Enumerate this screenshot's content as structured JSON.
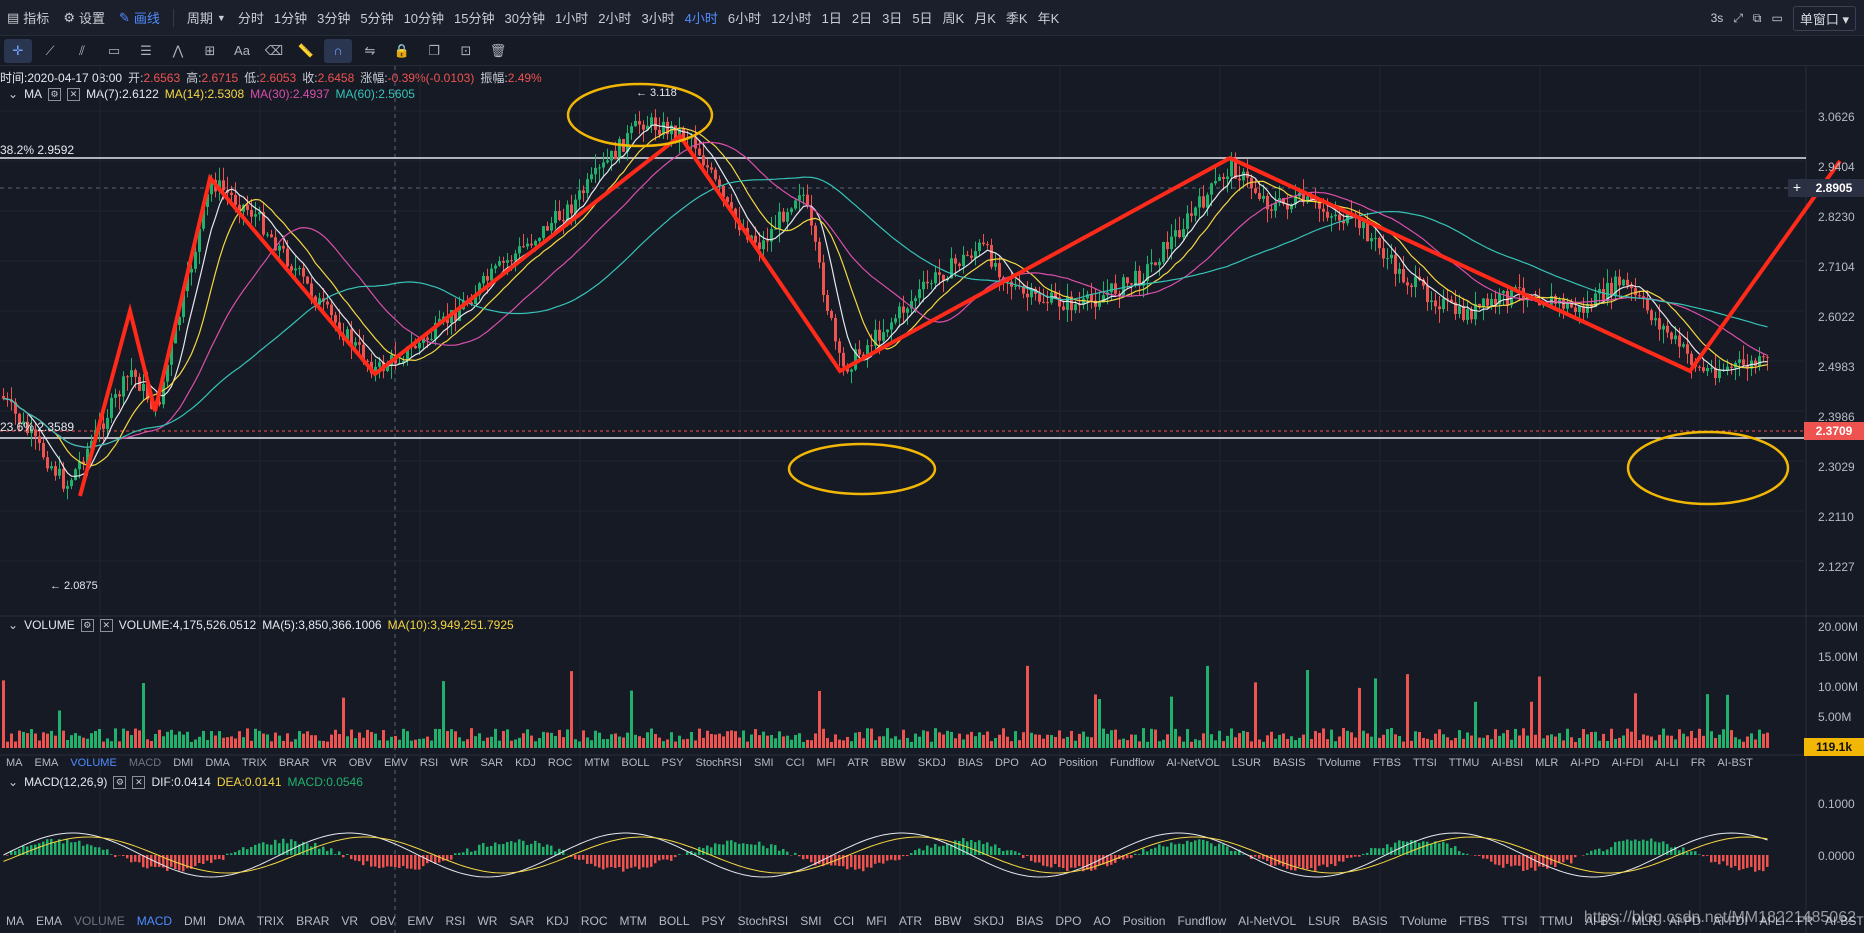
{
  "topbar": {
    "items": [
      {
        "icon": "indicator-icon",
        "label": "指标"
      },
      {
        "icon": "settings-icon",
        "label": "设置"
      },
      {
        "icon": "draw-icon",
        "label": "画线",
        "active": true
      }
    ],
    "period_label": "周期",
    "periods": [
      "分时",
      "1分钟",
      "3分钟",
      "5分钟",
      "10分钟",
      "15分钟",
      "30分钟",
      "1小时",
      "2小时",
      "3小时",
      "4小时",
      "6小时",
      "12小时",
      "1日",
      "2日",
      "3日",
      "5日",
      "周K",
      "月K",
      "季K",
      "年K"
    ],
    "active_period": "4小时",
    "refresh": "3s",
    "window_btn": "单窗口"
  },
  "ohlc": {
    "time": "时间:2020-04-17 08:00",
    "open_l": "开:",
    "open": "2.6563",
    "high_l": "高:",
    "high": "2.6715",
    "low_l": "低:",
    "low": "2.6053",
    "close_l": "收:",
    "close": "2.6458",
    "chg_l": "涨幅:",
    "chg": "-0.39%(-0.0103)",
    "amp_l": "振幅:",
    "amp": "2.49%"
  },
  "ma_legend": {
    "name": "MA",
    "ma7": "MA(7):2.6122",
    "ma14": "MA(14):2.5308",
    "ma30": "MA(30):2.4937",
    "ma60": "MA(60):2.5605"
  },
  "fib": {
    "f382": "38.2% 2.9592",
    "f236": "23.6% 2.3589"
  },
  "extremes": {
    "high": "← 3.118",
    "low": "← 2.0875"
  },
  "price_axis": [
    "3.0626",
    "2.9404",
    "2.8230",
    "2.7104",
    "2.6022",
    "2.4983",
    "2.3986",
    "2.3029",
    "2.2110",
    "2.1227"
  ],
  "crosshair_price": "2.8905",
  "last_price": "2.3709",
  "volume_legend": {
    "name": "VOLUME",
    "vol": "VOLUME:4,175,526.0512",
    "ma5": "MA(5):3,850,366.1006",
    "ma10": "MA(10):3,949,251.7925"
  },
  "volume_axis": [
    "20.00M",
    "15.00M",
    "10.00M",
    "5.00M"
  ],
  "last_volume": "119.1k",
  "indicator_tabs_1": [
    "MA",
    "EMA",
    "VOLUME",
    "MACD",
    "DMI",
    "DMA",
    "TRIX",
    "BRAR",
    "VR",
    "OBV",
    "EMV",
    "RSI",
    "WR",
    "SAR",
    "KDJ",
    "ROC",
    "MTM",
    "BOLL",
    "PSY",
    "StochRSI",
    "SMI",
    "CCI",
    "MFI",
    "ATR",
    "BBW",
    "SKDJ",
    "BIAS",
    "DPO",
    "AO",
    "Position",
    "Fundflow",
    "AI-NetVOL",
    "LSUR",
    "BASIS",
    "TVolume",
    "FTBS",
    "TTSI",
    "TTMU",
    "AI-BSI",
    "MLR",
    "AI-PD",
    "AI-FDI",
    "AI-LI",
    "FR",
    "AI-BST"
  ],
  "active_tab_1": "VOLUME",
  "macd_legend": {
    "name": "MACD(12,26,9)",
    "dif": "DIF:0.0414",
    "dea": "DEA:0.0141",
    "macd": "MACD:0.0546"
  },
  "macd_axis": [
    "0.1000",
    "0.0000"
  ],
  "indicator_tabs_2": [
    "MA",
    "EMA",
    "VOLUME",
    "MACD",
    "DMI",
    "DMA",
    "TRIX",
    "BRAR",
    "VR",
    "OBV",
    "EMV",
    "RSI",
    "WR",
    "SAR",
    "KDJ",
    "ROC",
    "MTM",
    "BOLL",
    "PSY",
    "StochRSI",
    "SMI",
    "CCI",
    "MFI",
    "ATR",
    "BBW",
    "SKDJ",
    "BIAS",
    "DPO",
    "AO",
    "Position",
    "Fundflow",
    "AI-NetVOL",
    "LSUR",
    "BASIS",
    "TVolume",
    "FTBS",
    "TTSI",
    "TTMU",
    "AI-BSI",
    "MLR",
    "AI-PD",
    "AI-FDI",
    "AI-LI",
    "FR",
    "AI-BST"
  ],
  "active_tab_2": "MACD",
  "watermark": "https://blog.csdn.net/MM18221485062",
  "colors": {
    "up": "#20b26c",
    "down": "#ef5350",
    "drawing": "#ff2a1a",
    "ellipse": "#f2b705",
    "ma7": "#e6e8ee",
    "ma14": "#f5d742",
    "ma30": "#d94fa9",
    "ma60": "#36c3b6"
  }
}
